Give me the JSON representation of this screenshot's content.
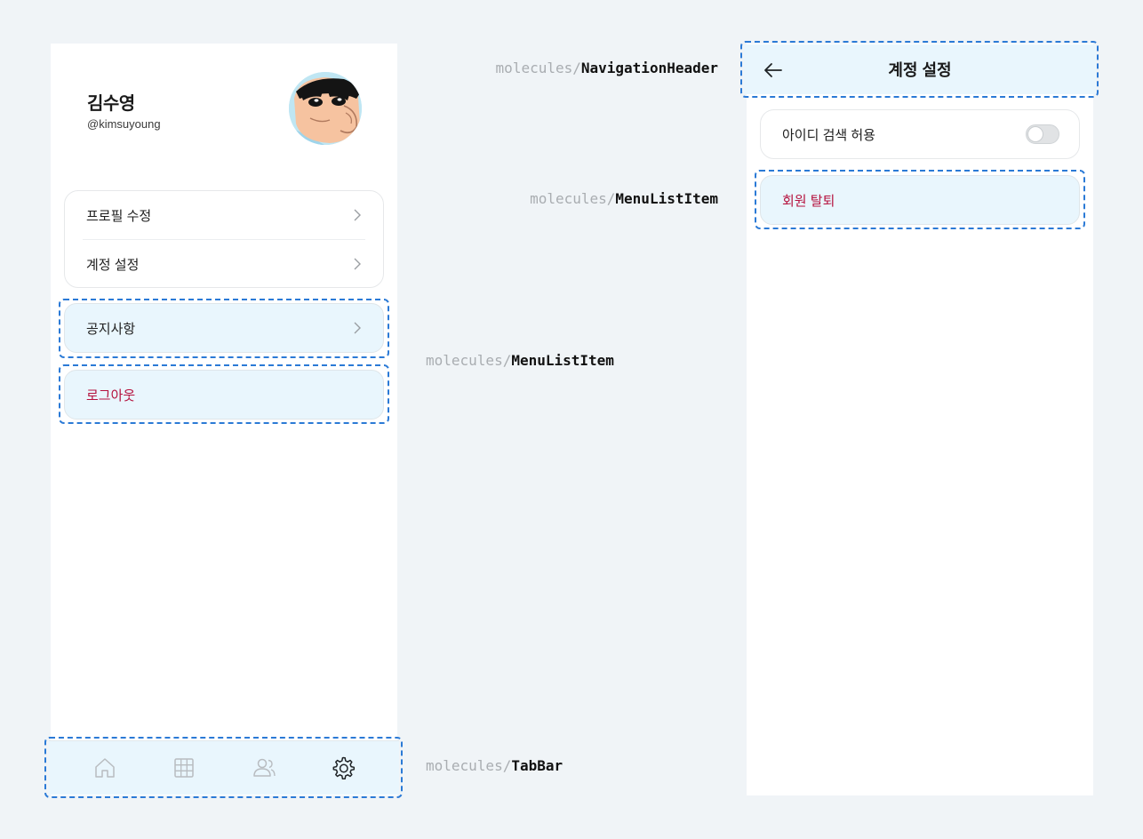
{
  "profile": {
    "name": "김수영",
    "handle": "@kimsuyoung"
  },
  "menu": {
    "items": [
      {
        "label": "프로필 수정"
      },
      {
        "label": "계정 설정"
      }
    ],
    "notice": "공지사항",
    "logout": "로그아웃"
  },
  "tabbar": {
    "tabs": [
      {
        "icon": "home-icon",
        "active": false
      },
      {
        "icon": "grid-icon",
        "active": false
      },
      {
        "icon": "users-icon",
        "active": false
      },
      {
        "icon": "settings-icon",
        "active": true
      }
    ]
  },
  "annotations": {
    "prefix": "molecules/",
    "navigation_header": "NavigationHeader",
    "menu_list_item_right": "MenuListItem",
    "menu_list_item_left": "MenuListItem",
    "tab_bar": "TabBar"
  },
  "account_settings": {
    "title": "계정 설정",
    "id_search_label": "아이디 검색 허용",
    "id_search_enabled": false,
    "withdraw_label": "회원 탈퇴"
  },
  "colors": {
    "background": "#f0f4f7",
    "highlight": "#e9f6fd",
    "dashed_border": "#2b7ad6",
    "danger": "#b5123e"
  }
}
